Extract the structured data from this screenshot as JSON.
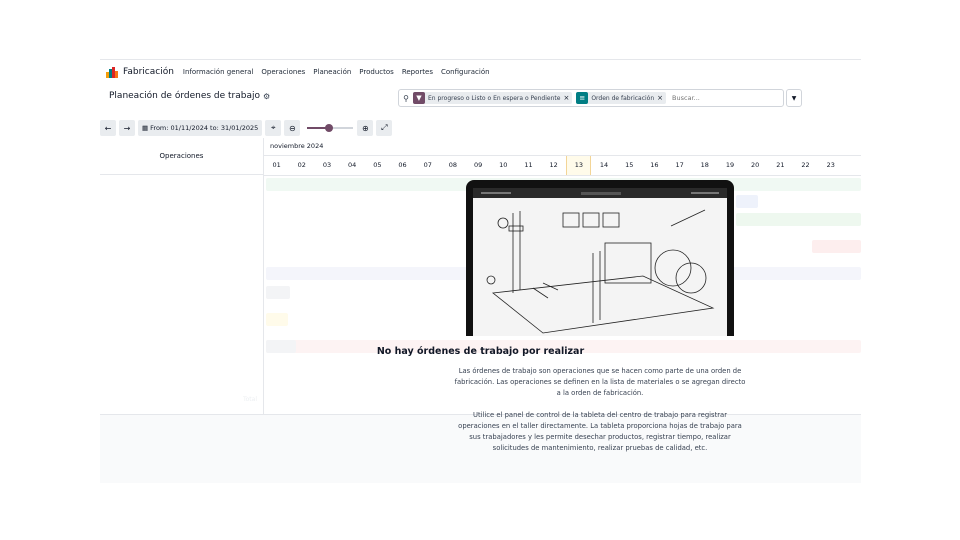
{
  "nav": {
    "brand": "Fabricación",
    "items": [
      "Información general",
      "Operaciones",
      "Planeación",
      "Productos",
      "Reportes",
      "Configuración"
    ]
  },
  "control_panel": {
    "title": "Planeación de órdenes de trabajo",
    "facets": [
      {
        "label": "En progreso o Listo o En espera o Pendiente",
        "icon": "filter-icon",
        "color": "#714b67"
      },
      {
        "label": "Orden de fabricación",
        "icon": "group-by-icon",
        "color": "#017e84"
      }
    ],
    "search_placeholder": "Buscar...",
    "date_range": "From: 01/11/2024 to: 31/01/2025"
  },
  "gantt": {
    "row_header": "Operaciones",
    "month": "noviembre 2024",
    "days": [
      "01",
      "02",
      "03",
      "04",
      "05",
      "06",
      "07",
      "08",
      "09",
      "10",
      "11",
      "12",
      "13",
      "14",
      "15",
      "16",
      "17",
      "18",
      "19",
      "20",
      "21",
      "22",
      "23"
    ],
    "today_index": 12,
    "total_label": "Total"
  },
  "empty_state": {
    "title": "No hay órdenes de trabajo por realizar",
    "p1_lines": [
      "Las órdenes de trabajo son operaciones que se hacen como parte de una orden de",
      "fabricación. Las operaciones se definen en la lista de materiales o se agregan directo",
      "a la orden de fabricación."
    ],
    "p2_lines": [
      "Utilice el panel de control de la tableta del centro de trabajo para registrar",
      "operaciones en el taller directamente. La tableta proporciona hojas de trabajo para",
      "sus trabajadores y les permite desechar productos, registrar tiempo, realizar",
      "solicitudes de mantenimiento, realizar pruebas de calidad, etc."
    ]
  },
  "colors": {
    "accent": "#714b67",
    "teal": "#017e84"
  }
}
